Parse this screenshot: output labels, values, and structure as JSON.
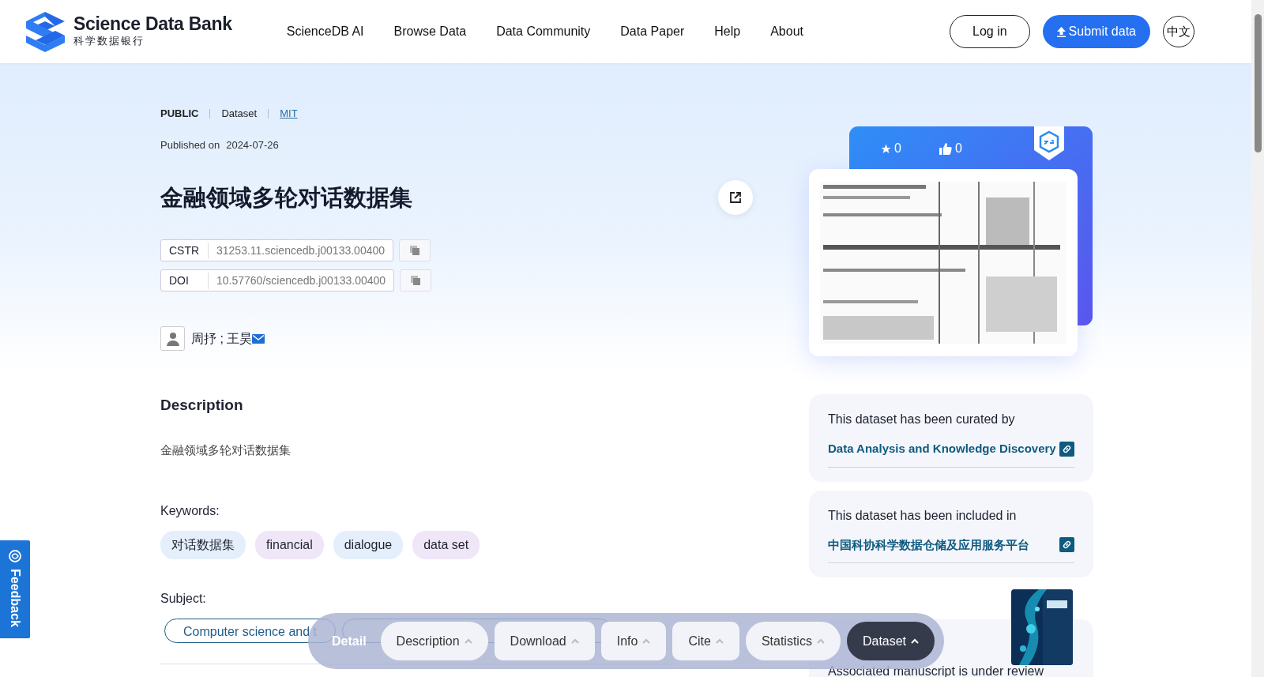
{
  "header": {
    "logo_title": "Science Data Bank",
    "logo_subtitle": "科学数据银行",
    "nav": [
      "ScienceDB AI",
      "Browse Data",
      "Data Community",
      "Data Paper",
      "Help",
      "About"
    ],
    "login": "Log in",
    "submit": "Submit data",
    "language": "中文"
  },
  "meta": {
    "access": "PUBLIC",
    "type": "Dataset",
    "license": "MIT",
    "published_label": "Published on",
    "published_date": "2024-07-26"
  },
  "title": "金融领域多轮对话数据集",
  "identifiers": [
    {
      "label": "CSTR",
      "value": "31253.11.sciencedb.j00133.00400"
    },
    {
      "label": "DOI",
      "value": "10.57760/sciencedb.j00133.00400"
    }
  ],
  "authors": "周抒 ; 王昊",
  "description": {
    "heading": "Description",
    "text": "金融领域多轮对话数据集"
  },
  "keywords": {
    "label": "Keywords:",
    "items": [
      {
        "text": "对话数据集",
        "color": "#e5effc"
      },
      {
        "text": "financial",
        "color": "#efe6f8"
      },
      {
        "text": "dialogue",
        "color": "#e5effc"
      },
      {
        "text": "data set",
        "color": "#efe6f8"
      }
    ]
  },
  "subject": {
    "label": "Subject:",
    "items": [
      "Computer science and t"
    ]
  },
  "stats": {
    "favorites": "0",
    "likes": "0"
  },
  "collections": [
    {
      "heading": "This dataset has been curated by",
      "link": "Data Analysis and Knowledge Discovery"
    },
    {
      "heading": "This dataset has been included in",
      "link": "中国科协科学数据仓储及应用服务平台"
    }
  ],
  "manuscript_note": "Associated manuscript is under review",
  "detail_bar": {
    "label": "Detail",
    "tabs": [
      {
        "label": "Description",
        "selected": false
      },
      {
        "label": "Download",
        "selected": false
      },
      {
        "label": "Info",
        "selected": false
      },
      {
        "label": "Cite",
        "selected": false
      },
      {
        "label": "Statistics",
        "selected": false
      },
      {
        "label": "Dataset",
        "selected": true
      }
    ]
  },
  "feedback": "Feedback"
}
